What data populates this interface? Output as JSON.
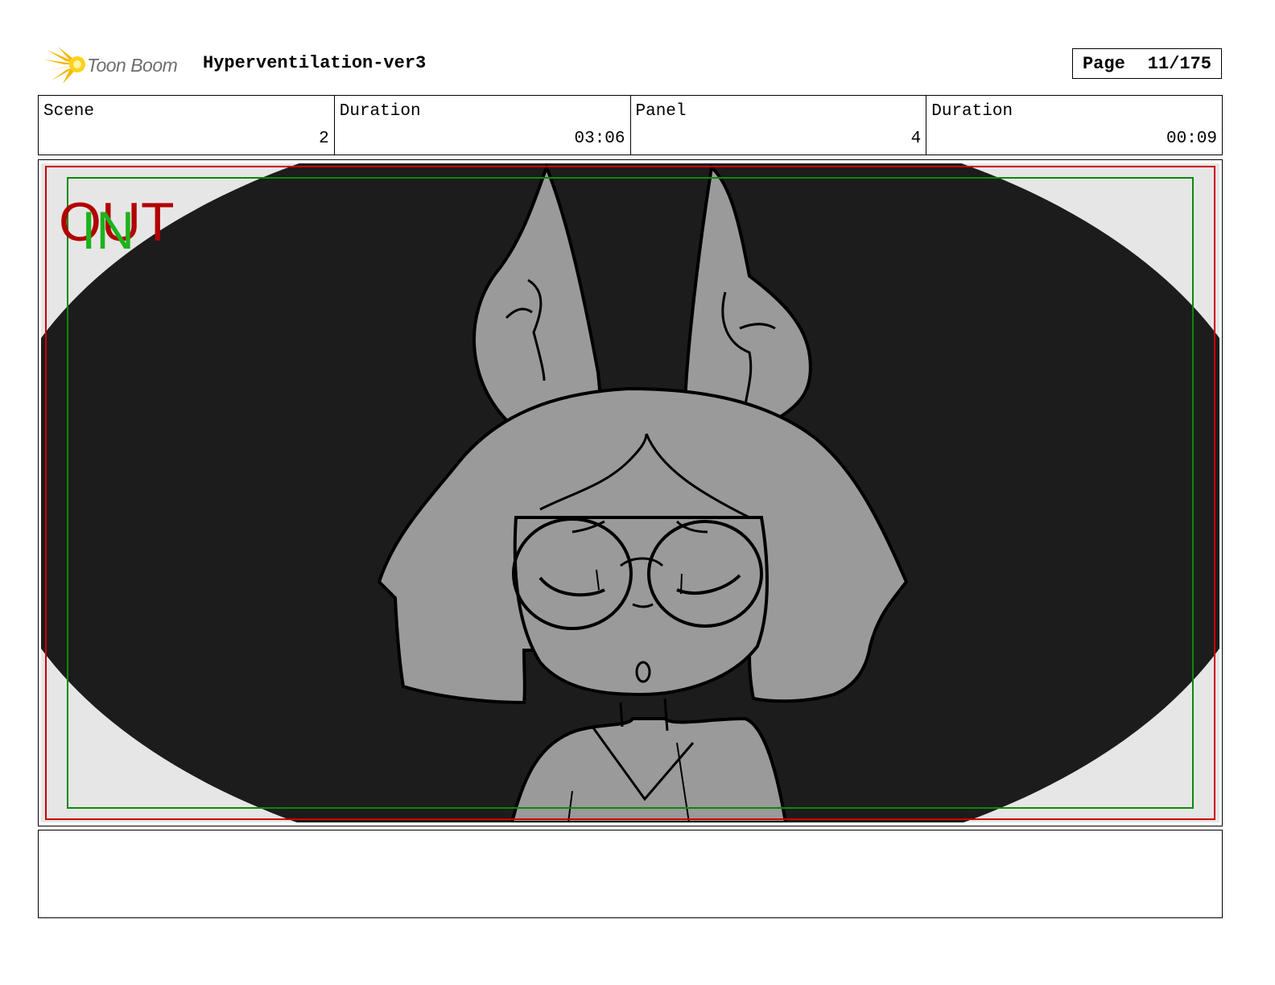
{
  "header": {
    "logo_text": "Toon Boom",
    "project_title": "Hyperventilation-ver3",
    "page_label": "Page",
    "page_number": "11/175"
  },
  "info": {
    "scene_label": "Scene",
    "scene_value": "2",
    "scene_duration_label": "Duration",
    "scene_duration_value": "03:06",
    "panel_label": "Panel",
    "panel_value": "4",
    "panel_duration_label": "Duration",
    "panel_duration_value": "00:09"
  },
  "panel": {
    "out_marker": "OUT",
    "in_marker": "IN",
    "colors": {
      "background": "#1c1c1c",
      "character_fill": "#9a9a9a",
      "vignette": "#e6e6e6",
      "out_marker": "#b30000",
      "in_marker": "#1db31d",
      "safe_frame_red": "#cc0000",
      "safe_frame_green": "#0a8a0a"
    }
  },
  "notes": {
    "text": ""
  }
}
